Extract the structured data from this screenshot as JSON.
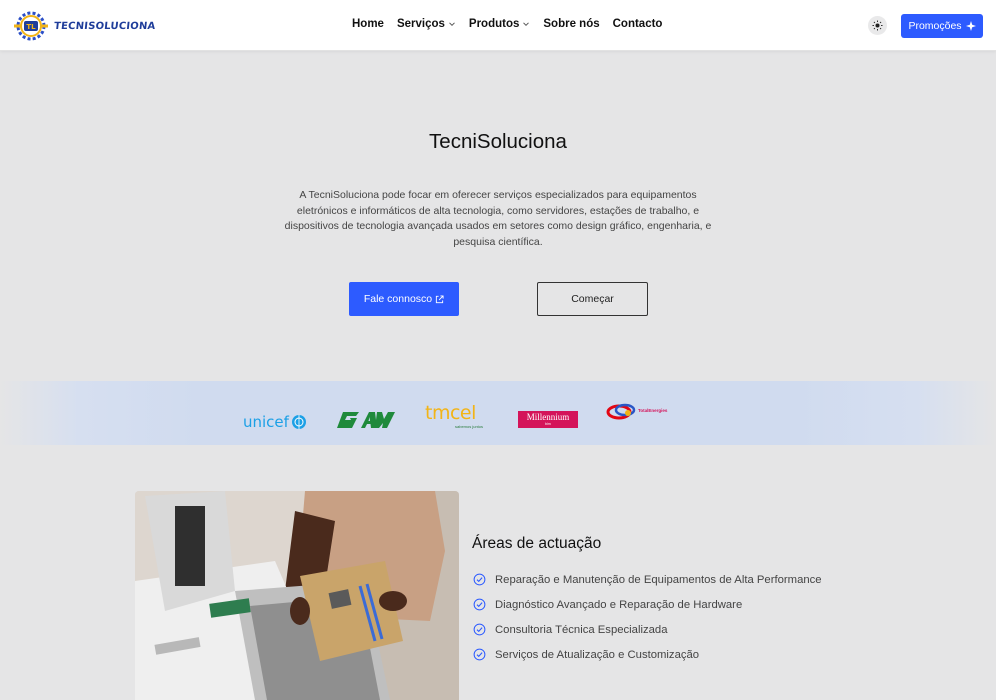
{
  "header": {
    "brand": "TECNISOLUCIONA",
    "nav": [
      {
        "label": "Home",
        "dropdown": false
      },
      {
        "label": "Serviços",
        "dropdown": true
      },
      {
        "label": "Produtos",
        "dropdown": true
      },
      {
        "label": "Sobre nós",
        "dropdown": false
      },
      {
        "label": "Contacto",
        "dropdown": false
      }
    ],
    "theme_icon": "sun-icon",
    "promo_label": "Promoções",
    "promo_icon": "sparkle-icon"
  },
  "hero": {
    "title": "TecniSoluciona",
    "description": "A TecniSoluciona pode focar em oferecer serviços especializados para equipamentos eletrónicos e informáticos de alta tecnologia, como servidores, estações de trabalho, e dispositivos de tecnologia avançada usados em setores como design gráfico, engenharia, e pesquisa científica.",
    "primary_label": "Fale connosco",
    "secondary_label": "Começar"
  },
  "partners": [
    {
      "name": "unicef",
      "text": "unicef"
    },
    {
      "name": "gam",
      "text": ""
    },
    {
      "name": "tmcel",
      "text": "tmcel",
      "tagline": "sabemos juntos"
    },
    {
      "name": "millennium",
      "text": "Millennium",
      "subtext": "bim"
    },
    {
      "name": "totalenergies",
      "text": "TotalEnergies"
    }
  ],
  "areas": {
    "title": "Áreas de actuação",
    "items": [
      "Reparação e Manutenção de Equipamentos de Alta Performance",
      "Diagnóstico Avançado e Reparação de Hardware",
      "Consultoria Técnica Especializada",
      "Serviços de Atualização e Customização"
    ]
  },
  "colors": {
    "accent": "#2d5bff",
    "brand_text": "#1f3d9a",
    "band": "#d0dbef",
    "background": "#e5e5e6"
  }
}
